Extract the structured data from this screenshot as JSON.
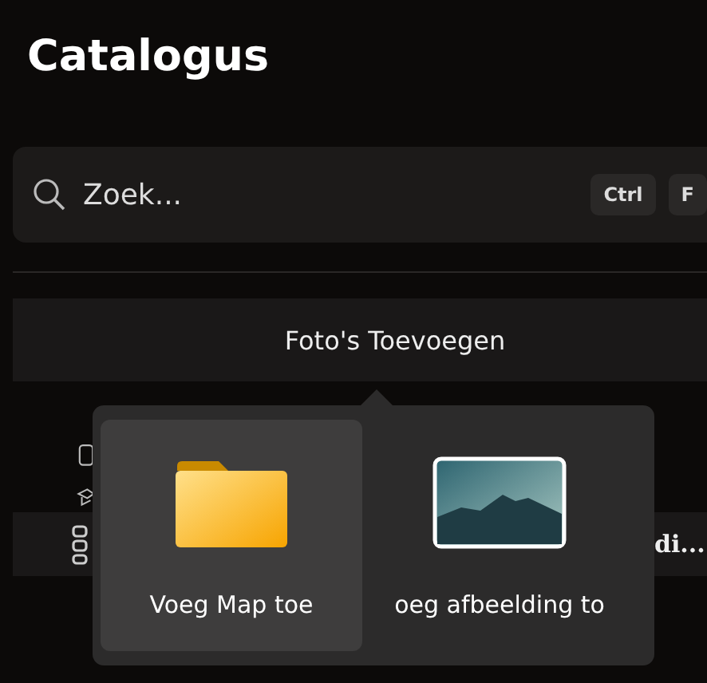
{
  "title": "Catalogus",
  "search": {
    "placeholder": "Zoek...",
    "shortcut": [
      "Ctrl",
      "F"
    ]
  },
  "add_button": {
    "label": "Foto's Toevoegen"
  },
  "background_row": {
    "label": "di..."
  },
  "flyout": {
    "items": [
      {
        "kind": "folder",
        "label": "Voeg Map toe",
        "selected": true
      },
      {
        "kind": "image",
        "label": "oeg afbeelding to",
        "selected": false
      }
    ]
  }
}
